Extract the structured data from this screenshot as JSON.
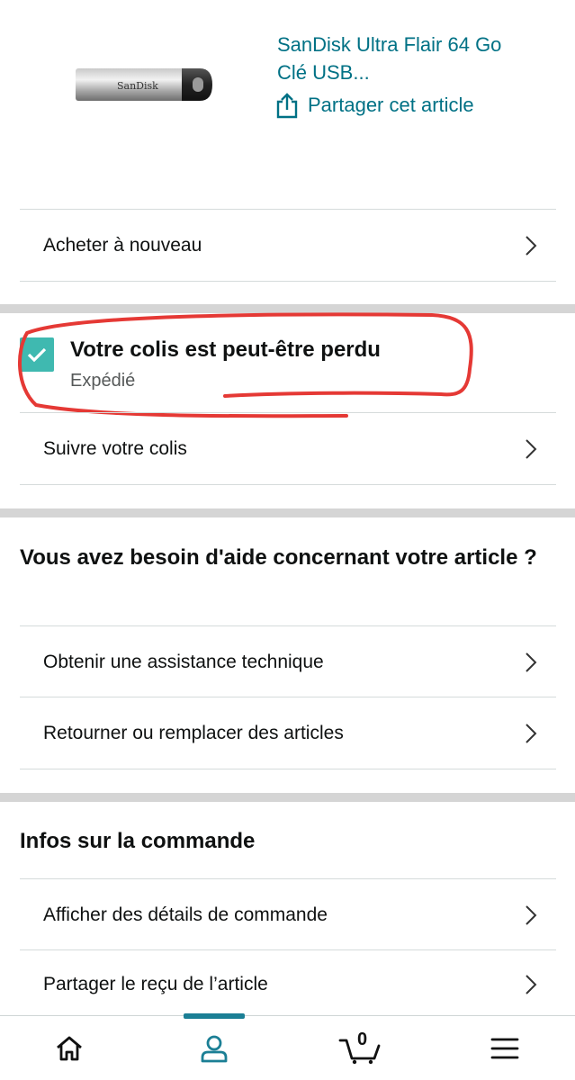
{
  "product": {
    "title_line1": "SanDisk Ultra Flair 64 Go",
    "title_line2": "Clé USB...",
    "share_label": "Partager cet article",
    "image_brand": "SanDisk"
  },
  "buy_again": {
    "label": "Acheter à nouveau"
  },
  "status": {
    "title": "Votre colis est peut-être perdu",
    "subtitle": "Expédié",
    "track_label": "Suivre votre colis",
    "accent": "#3fb9b0"
  },
  "help_section": {
    "title": "Vous avez besoin d'aide concernant votre article ?",
    "items": [
      {
        "label": "Obtenir une assistance technique"
      },
      {
        "label": "Retourner ou remplacer des articles"
      }
    ]
  },
  "order_info": {
    "title": "Infos sur la commande",
    "items": [
      {
        "label": "Afficher des détails de commande"
      },
      {
        "label": "Partager le reçu de l’article"
      }
    ]
  },
  "tabbar": {
    "items": [
      {
        "icon": "home-icon"
      },
      {
        "icon": "account-icon",
        "active": true
      },
      {
        "icon": "cart-icon",
        "badge": "0"
      },
      {
        "icon": "menu-icon"
      }
    ],
    "active_color": "#1b7f95"
  },
  "annotation_color": "#e53935"
}
